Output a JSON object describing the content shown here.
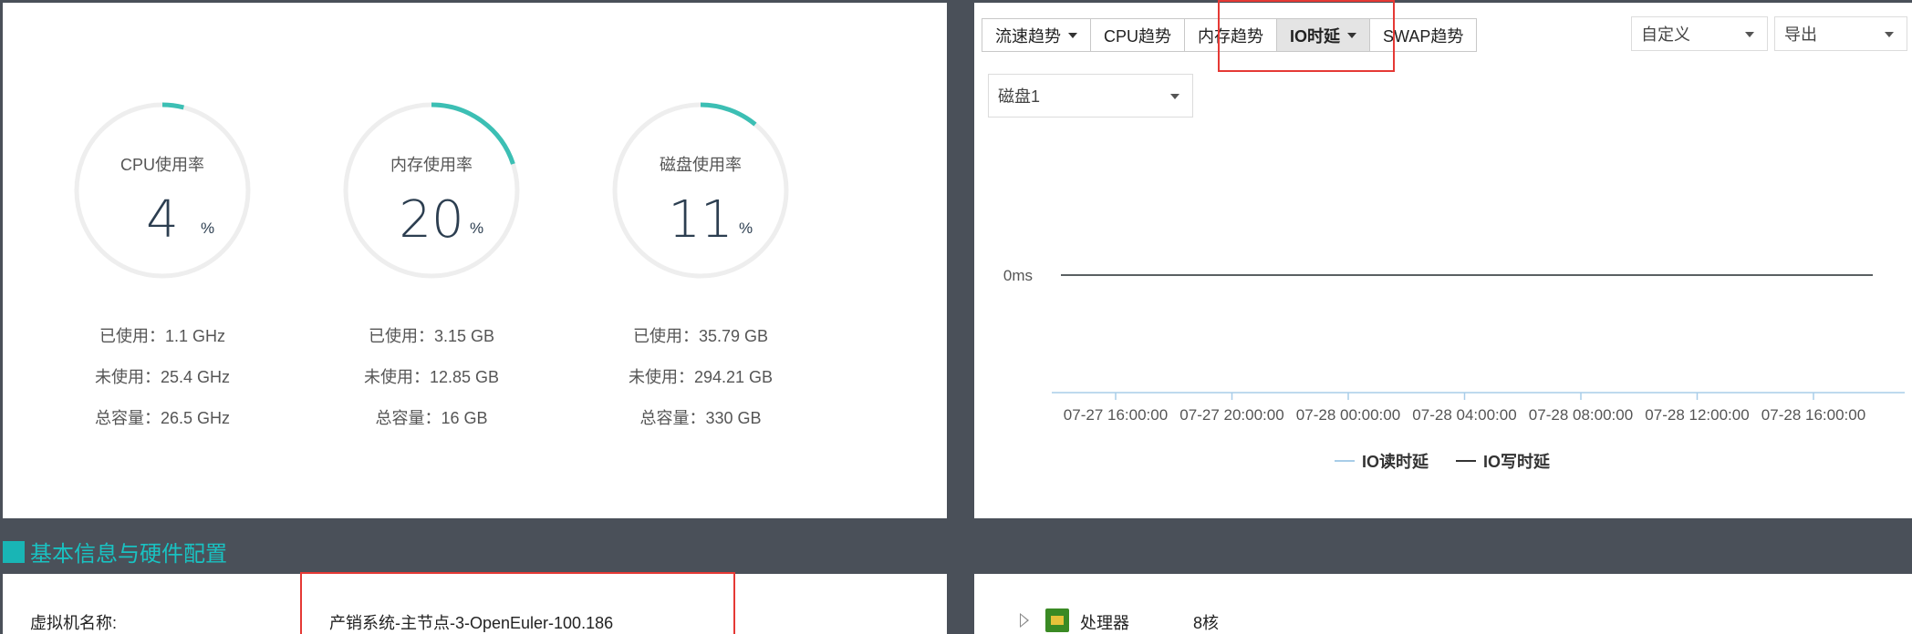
{
  "gauges": [
    {
      "label": "CPU使用率",
      "value": "4",
      "unit": "%",
      "percent": 4,
      "used": "已使用：1.1 GHz",
      "unused": "未使用：25.4 GHz",
      "total": "总容量：26.5 GHz"
    },
    {
      "label": "内存使用率",
      "value": "20",
      "unit": "%",
      "percent": 20,
      "used": "已使用：3.15 GB",
      "unused": "未使用：12.85 GB",
      "total": "总容量：16 GB"
    },
    {
      "label": "磁盘使用率",
      "value": "11",
      "unit": "%",
      "percent": 11,
      "used": "已使用：35.79 GB",
      "unused": "未使用：294.21 GB",
      "total": "总容量：330 GB"
    }
  ],
  "colors": {
    "gauge_fill": "#3cbfb4",
    "gauge_track": "#eeeeee",
    "accent": "#19b5b5",
    "highlight": "#e53935",
    "background": "#4a5059"
  },
  "toolbar": {
    "tabs": [
      {
        "label": "流速趋势",
        "dropdown": true,
        "active": false
      },
      {
        "label": "CPU趋势",
        "dropdown": false,
        "active": false
      },
      {
        "label": "内存趋势",
        "dropdown": false,
        "active": false
      },
      {
        "label": "IO时延",
        "dropdown": true,
        "active": true
      },
      {
        "label": "SWAP趋势",
        "dropdown": false,
        "active": false
      }
    ],
    "range_select": "自定义",
    "export_select": "导出",
    "disk_select": "磁盘1"
  },
  "chart_data": {
    "type": "line",
    "y_tick_labels": [
      "0ms"
    ],
    "x_tick_labels": [
      "07-27 16:00:00",
      "07-27 20:00:00",
      "07-28 00:00:00",
      "07-28 04:00:00",
      "07-28 08:00:00",
      "07-28 12:00:00",
      "07-28 16:00:00"
    ],
    "series": [
      {
        "name": "IO读时延",
        "color": "#a8cde8",
        "values": [
          0,
          0,
          0,
          0,
          0,
          0,
          0
        ]
      },
      {
        "name": "IO写时延",
        "color": "#333333",
        "values": [
          0,
          0,
          0,
          0,
          0,
          0,
          0
        ]
      }
    ],
    "legend": "bottom-center"
  },
  "section": {
    "title": "基本信息与硬件配置"
  },
  "info": {
    "vm_name_label": "虚拟机名称:",
    "vm_name_value": "产销系统-主节点-3-OpenEuler-100.186"
  },
  "hardware": {
    "name": "处理器",
    "value": "8核",
    "icon": "cpu-chip-icon"
  }
}
